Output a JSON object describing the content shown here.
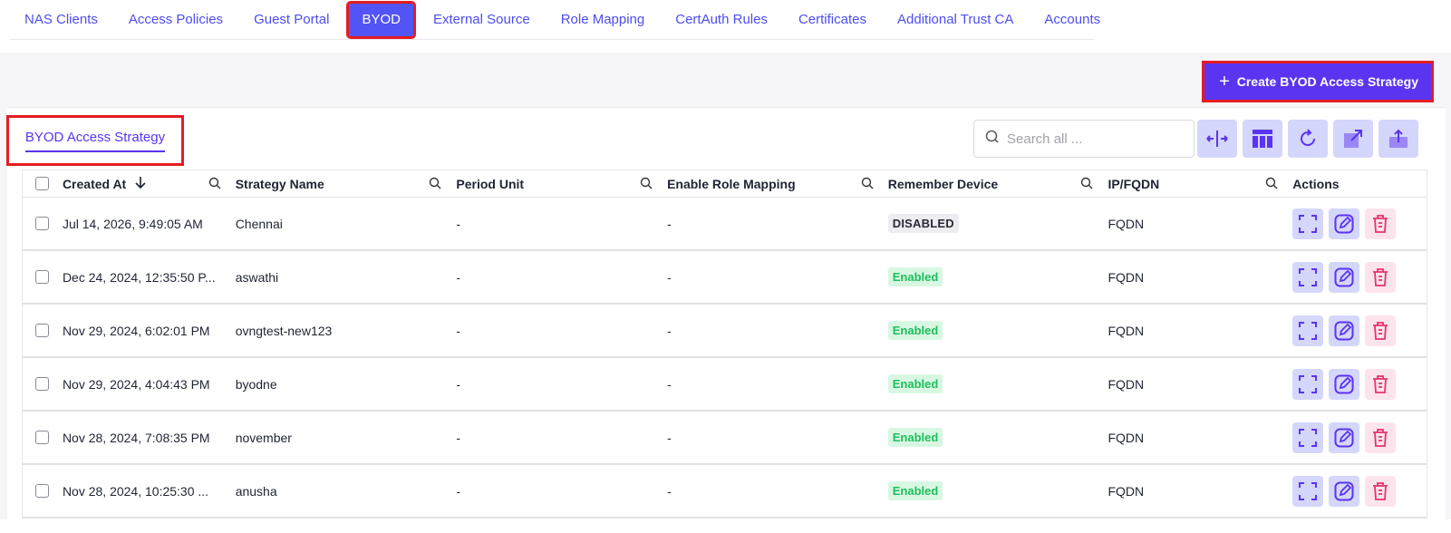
{
  "topnav": {
    "tabs": [
      {
        "label": "NAS Clients"
      },
      {
        "label": "Access Policies"
      },
      {
        "label": "Guest Portal"
      },
      {
        "label": "BYOD",
        "active": true
      },
      {
        "label": "External Source"
      },
      {
        "label": "Role Mapping"
      },
      {
        "label": "CertAuth Rules"
      },
      {
        "label": "Certificates"
      },
      {
        "label": "Additional Trust CA"
      },
      {
        "label": "Accounts"
      }
    ]
  },
  "actions": {
    "create_label": "Create BYOD Access Strategy",
    "create_icon": "plus-icon"
  },
  "subtab": {
    "label": "BYOD Access Strategy"
  },
  "search": {
    "placeholder": "Search all ...",
    "value": ""
  },
  "toolbar": {
    "icons": [
      "column-resize-icon",
      "table-layout-icon",
      "refresh-icon",
      "export-icon",
      "upload-icon"
    ]
  },
  "table": {
    "headers": {
      "created_at": "Created At",
      "strategy_name": "Strategy Name",
      "period_unit": "Period Unit",
      "enable_role_mapping": "Enable Role Mapping",
      "remember_device": "Remember Device",
      "ip_fqdn": "IP/FQDN",
      "actions": "Actions"
    },
    "sort": {
      "column": "created_at",
      "direction": "desc"
    },
    "rows": [
      {
        "created_at": "Jul 14, 2026, 9:49:05 AM",
        "strategy_name": "Chennai",
        "period_unit": "-",
        "enable_role_mapping": "-",
        "remember_device": "DISABLED",
        "ip_fqdn": "FQDN"
      },
      {
        "created_at": "Dec 24, 2024, 12:35:50 P...",
        "strategy_name": "aswathi",
        "period_unit": "-",
        "enable_role_mapping": "-",
        "remember_device": "Enabled",
        "ip_fqdn": "FQDN"
      },
      {
        "created_at": "Nov 29, 2024, 6:02:01 PM",
        "strategy_name": "ovngtest-new123",
        "period_unit": "-",
        "enable_role_mapping": "-",
        "remember_device": "Enabled",
        "ip_fqdn": "FQDN"
      },
      {
        "created_at": "Nov 29, 2024, 4:04:43 PM",
        "strategy_name": "byodne",
        "period_unit": "-",
        "enable_role_mapping": "-",
        "remember_device": "Enabled",
        "ip_fqdn": "FQDN"
      },
      {
        "created_at": "Nov 28, 2024, 7:08:35 PM",
        "strategy_name": "november",
        "period_unit": "-",
        "enable_role_mapping": "-",
        "remember_device": "Enabled",
        "ip_fqdn": "FQDN"
      },
      {
        "created_at": "Nov 28, 2024, 10:25:30 ...",
        "strategy_name": "anusha",
        "period_unit": "-",
        "enable_role_mapping": "-",
        "remember_device": "Enabled",
        "ip_fqdn": "FQDN"
      }
    ]
  },
  "colors": {
    "accent": "#5a34f0",
    "tab_active": "#5254f5",
    "link": "#4d4df0",
    "highlight": "#e51c23",
    "enabled_text": "#1fbf5c",
    "enabled_bg": "#d8f7e3",
    "delete": "#e5336b"
  }
}
